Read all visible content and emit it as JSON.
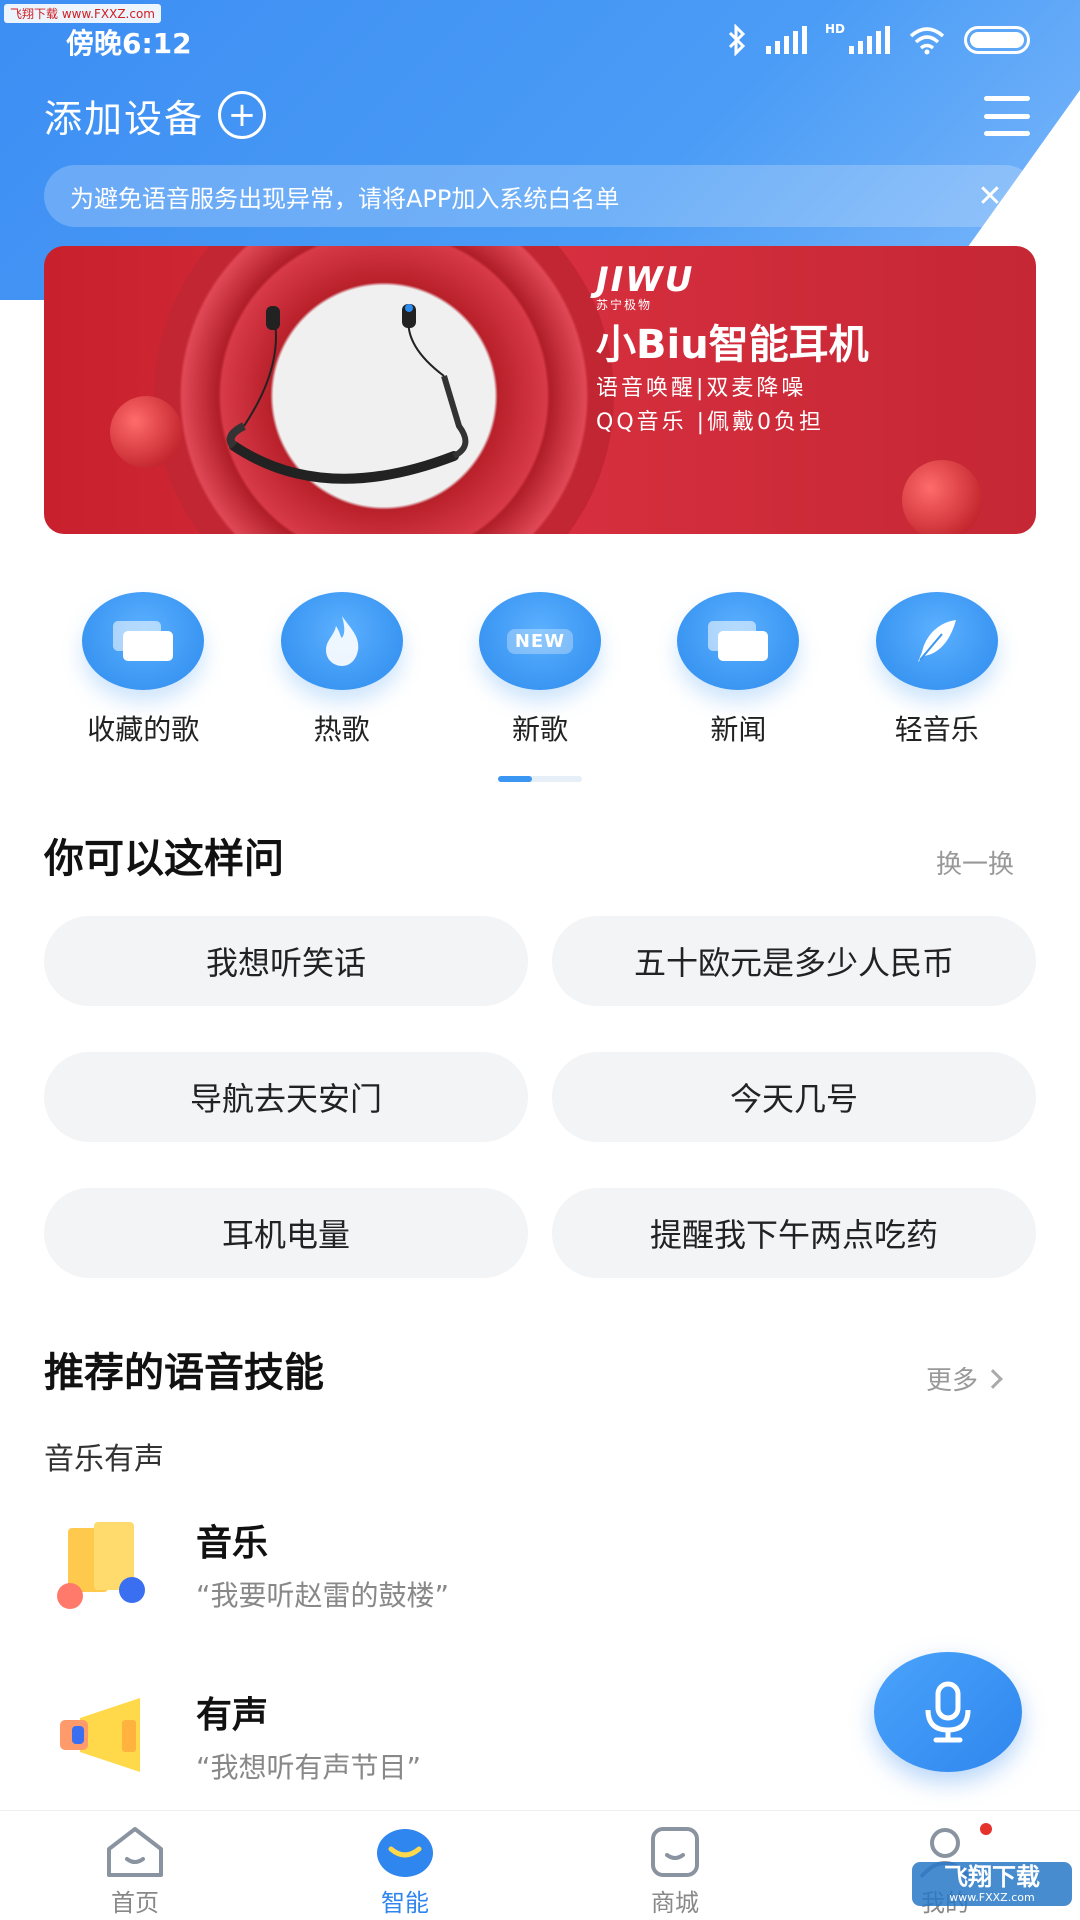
{
  "watermark": {
    "top": "飞翔下载 www.FXXZ.com",
    "bottom_title": "飞翔下载",
    "bottom_url": "www.FXXZ.com"
  },
  "status_bar": {
    "time": "傍晚6:12",
    "network": "HD"
  },
  "header": {
    "title": "添加设备"
  },
  "notice": {
    "text": "为避免语音服务出现异常，请将APP加入系统白名单"
  },
  "banner": {
    "brand": "JIWU",
    "brand_sub": "苏宁极物",
    "title": "小Biu智能耳机",
    "line1": "语音唤醒|双麦降噪",
    "line2": "QQ音乐 |佩戴0负担"
  },
  "categories": [
    {
      "label": "收藏的歌",
      "icon": "cards-icon"
    },
    {
      "label": "热歌",
      "icon": "flame-icon"
    },
    {
      "label": "新歌",
      "icon": "new-icon",
      "tag": "NEW"
    },
    {
      "label": "新闻",
      "icon": "news-icon"
    },
    {
      "label": "轻音乐",
      "icon": "feather-icon"
    }
  ],
  "ask": {
    "title": "你可以这样问",
    "refresh": "换一换",
    "chips": [
      "我想听笑话",
      "五十欧元是多少人民币",
      "导航去天安门",
      "今天几号",
      "耳机电量",
      "提醒我下午两点吃药"
    ]
  },
  "skills": {
    "title": "推荐的语音技能",
    "more": "更多",
    "subcategory": "音乐有声",
    "items": [
      {
        "name": "音乐",
        "desc": "“我要听赵雷的鼓楼”",
        "icon": "music-skill-icon"
      },
      {
        "name": "有声",
        "desc": "“我想听有声节目”",
        "icon": "audio-skill-icon"
      }
    ]
  },
  "tabbar": {
    "items": [
      {
        "label": "首页",
        "active": false
      },
      {
        "label": "智能",
        "active": true
      },
      {
        "label": "商城",
        "active": false
      },
      {
        "label": "我的",
        "active": false
      }
    ]
  },
  "colors": {
    "primary": "#3a96f2",
    "banner_red": "#d93040",
    "chip_bg": "#f3f4f6"
  }
}
